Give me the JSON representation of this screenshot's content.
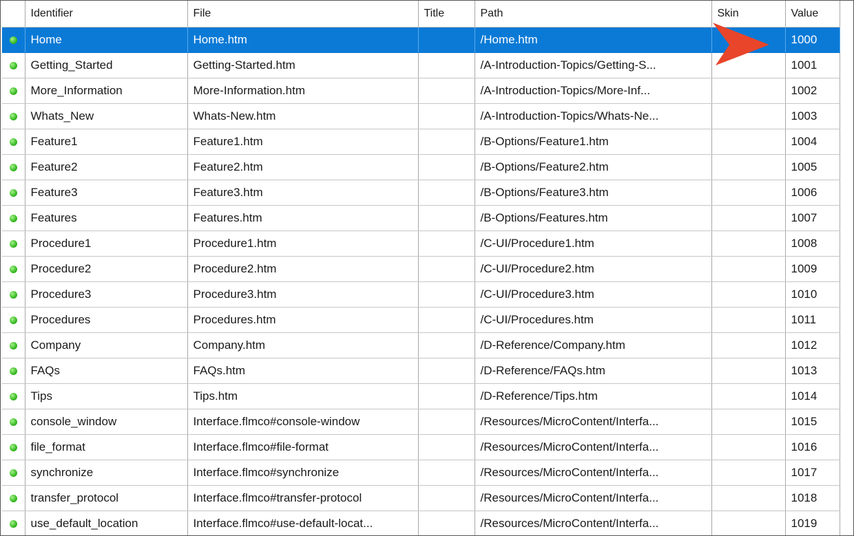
{
  "columns": {
    "status": "",
    "identifier": "Identifier",
    "file": "File",
    "title": "Title",
    "path": "Path",
    "skin": "Skin",
    "value": "Value"
  },
  "status_icon": "green-status-dot-icon",
  "selection_color": "#0b7ad6",
  "arrow_color": "#e8452a",
  "rows": [
    {
      "identifier": "Home",
      "file": "Home.htm",
      "title": "",
      "path": "/Home.htm",
      "skin": "",
      "value": "1000",
      "selected": true
    },
    {
      "identifier": "Getting_Started",
      "file": "Getting-Started.htm",
      "title": "",
      "path": "/A-Introduction-Topics/Getting-S...",
      "skin": "",
      "value": "1001"
    },
    {
      "identifier": "More_Information",
      "file": "More-Information.htm",
      "title": "",
      "path": "/A-Introduction-Topics/More-Inf...",
      "skin": "",
      "value": "1002"
    },
    {
      "identifier": "Whats_New",
      "file": "Whats-New.htm",
      "title": "",
      "path": "/A-Introduction-Topics/Whats-Ne...",
      "skin": "",
      "value": "1003"
    },
    {
      "identifier": "Feature1",
      "file": "Feature1.htm",
      "title": "",
      "path": "/B-Options/Feature1.htm",
      "skin": "",
      "value": "1004"
    },
    {
      "identifier": "Feature2",
      "file": "Feature2.htm",
      "title": "",
      "path": "/B-Options/Feature2.htm",
      "skin": "",
      "value": "1005"
    },
    {
      "identifier": "Feature3",
      "file": "Feature3.htm",
      "title": "",
      "path": "/B-Options/Feature3.htm",
      "skin": "",
      "value": "1006"
    },
    {
      "identifier": "Features",
      "file": "Features.htm",
      "title": "",
      "path": "/B-Options/Features.htm",
      "skin": "",
      "value": "1007"
    },
    {
      "identifier": "Procedure1",
      "file": "Procedure1.htm",
      "title": "",
      "path": "/C-UI/Procedure1.htm",
      "skin": "",
      "value": "1008"
    },
    {
      "identifier": "Procedure2",
      "file": "Procedure2.htm",
      "title": "",
      "path": "/C-UI/Procedure2.htm",
      "skin": "",
      "value": "1009"
    },
    {
      "identifier": "Procedure3",
      "file": "Procedure3.htm",
      "title": "",
      "path": "/C-UI/Procedure3.htm",
      "skin": "",
      "value": "1010"
    },
    {
      "identifier": "Procedures",
      "file": "Procedures.htm",
      "title": "",
      "path": "/C-UI/Procedures.htm",
      "skin": "",
      "value": "1011"
    },
    {
      "identifier": "Company",
      "file": "Company.htm",
      "title": "",
      "path": "/D-Reference/Company.htm",
      "skin": "",
      "value": "1012"
    },
    {
      "identifier": "FAQs",
      "file": "FAQs.htm",
      "title": "",
      "path": "/D-Reference/FAQs.htm",
      "skin": "",
      "value": "1013"
    },
    {
      "identifier": "Tips",
      "file": "Tips.htm",
      "title": "",
      "path": "/D-Reference/Tips.htm",
      "skin": "",
      "value": "1014"
    },
    {
      "identifier": "console_window",
      "file": "Interface.flmco#console-window",
      "title": "",
      "path": "/Resources/MicroContent/Interfa...",
      "skin": "",
      "value": "1015"
    },
    {
      "identifier": "file_format",
      "file": "Interface.flmco#file-format",
      "title": "",
      "path": "/Resources/MicroContent/Interfa...",
      "skin": "",
      "value": "1016"
    },
    {
      "identifier": "synchronize",
      "file": "Interface.flmco#synchronize",
      "title": "",
      "path": "/Resources/MicroContent/Interfa...",
      "skin": "",
      "value": "1017"
    },
    {
      "identifier": "transfer_protocol",
      "file": "Interface.flmco#transfer-protocol",
      "title": "",
      "path": "/Resources/MicroContent/Interfa...",
      "skin": "",
      "value": "1018"
    },
    {
      "identifier": "use_default_location",
      "file": "Interface.flmco#use-default-locat...",
      "title": "",
      "path": "/Resources/MicroContent/Interfa...",
      "skin": "",
      "value": "1019"
    }
  ]
}
